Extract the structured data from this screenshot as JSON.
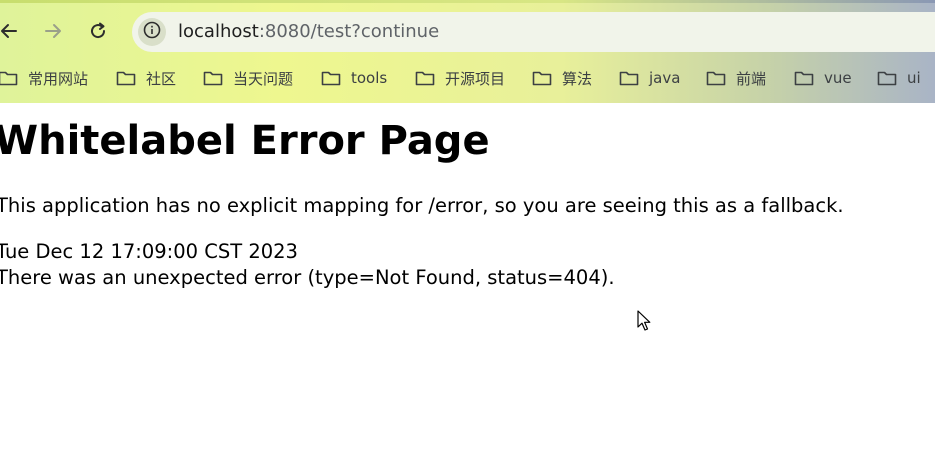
{
  "browser": {
    "url_host": "localhost",
    "url_rest": ":8080/test?continue",
    "icons": {
      "back": "arrow-left-icon",
      "forward": "arrow-right-icon",
      "reload": "reload-icon",
      "site_info": "info-circle-icon",
      "folder": "folder-icon"
    },
    "bookmarks": [
      {
        "label": "常用网站"
      },
      {
        "label": "社区"
      },
      {
        "label": "当天问题"
      },
      {
        "label": "tools"
      },
      {
        "label": "开源项目"
      },
      {
        "label": "算法"
      },
      {
        "label": "java"
      },
      {
        "label": "前端"
      },
      {
        "label": "vue"
      },
      {
        "label": "ui"
      }
    ]
  },
  "page": {
    "title": "Whitelabel Error Page",
    "description": "This application has no explicit mapping for /error, so you are seeing this as a fallback.",
    "timestamp": "Tue Dec 12 17:09:00 CST 2023",
    "detail": "There was an unexpected error (type=Not Found, status=404)."
  },
  "colors": {
    "chrome_gradient_start": "#dff39a",
    "chrome_gradient_end": "#a9b4c6",
    "omnibox_bg": "#f1f4ea"
  }
}
